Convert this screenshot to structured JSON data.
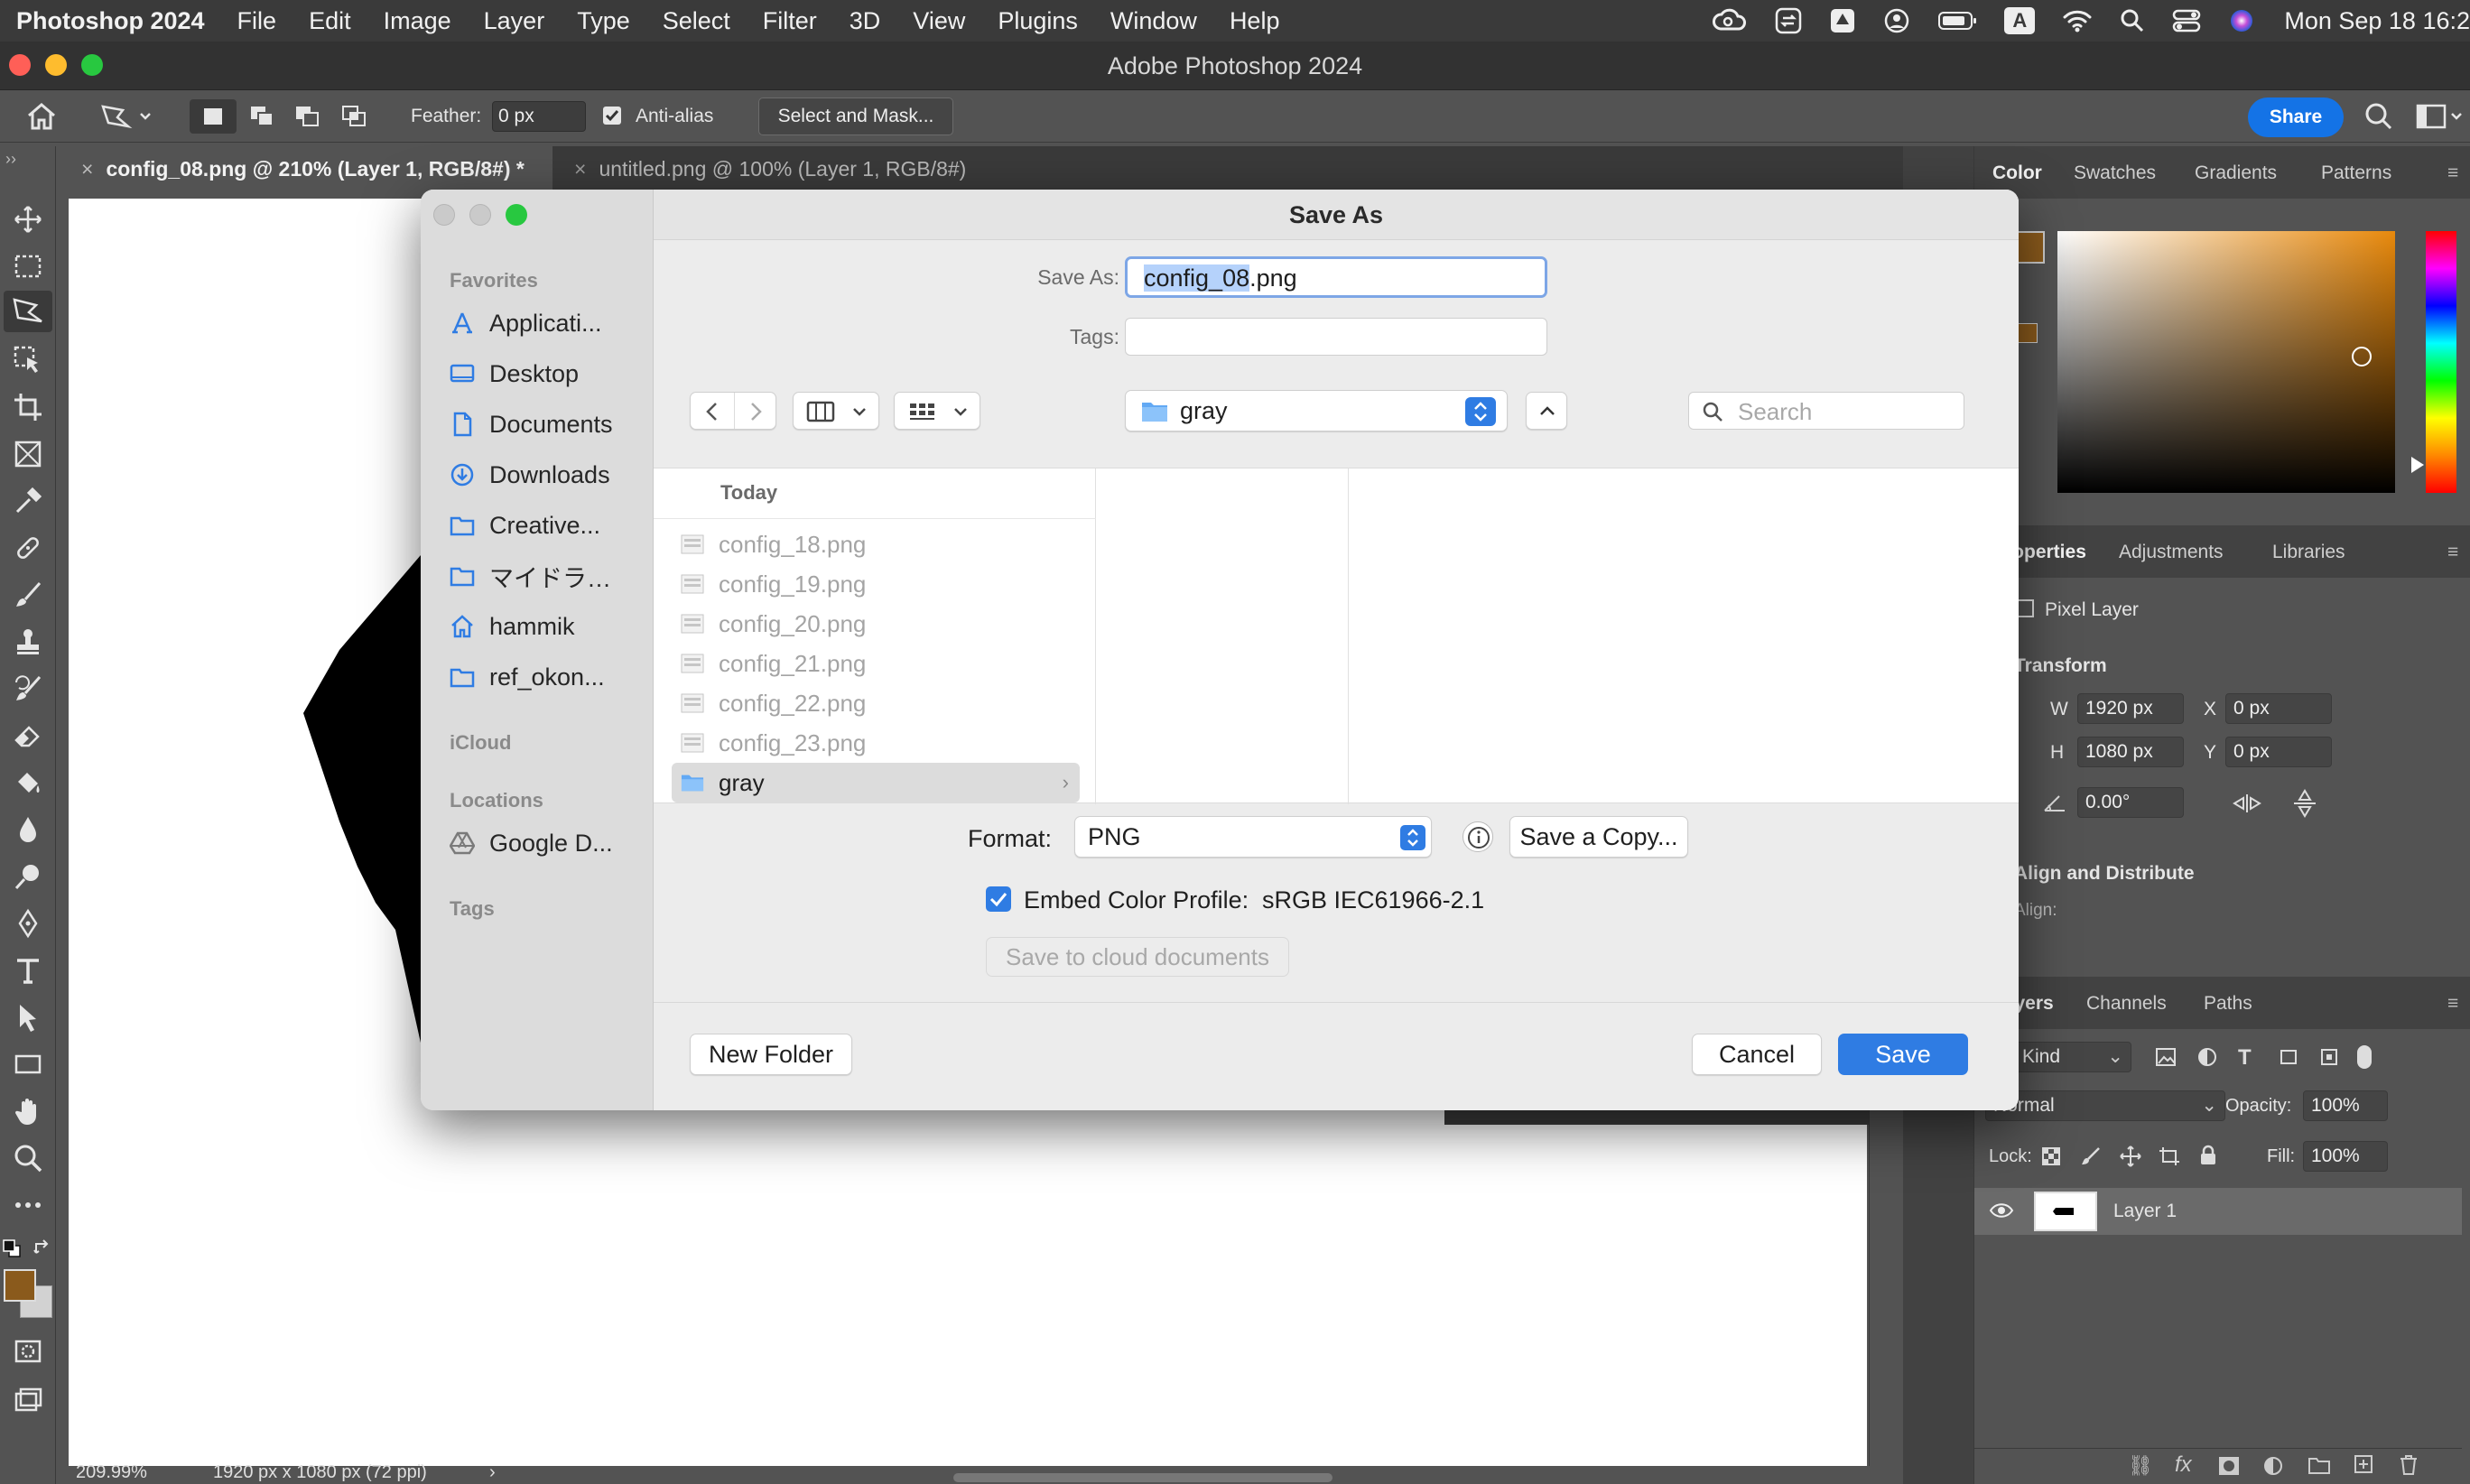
{
  "menubar": {
    "app": "Photoshop 2024",
    "items": [
      "File",
      "Edit",
      "Image",
      "Layer",
      "Type",
      "Select",
      "Filter",
      "3D",
      "View",
      "Plugins",
      "Window",
      "Help"
    ],
    "clock": "Mon Sep 18  16:2",
    "input_indicator": "A"
  },
  "window": {
    "title": "Adobe Photoshop 2024"
  },
  "options": {
    "feather_label": "Feather:",
    "feather_value": "0 px",
    "antialias_label": "Anti-alias",
    "antialias_checked": true,
    "select_mask": "Select and Mask...",
    "share": "Share"
  },
  "tabs": [
    {
      "label": "config_08.png @ 210% (Layer 1, RGB/8#) *",
      "active": true
    },
    {
      "label": "untitled.png @ 100% (Layer 1, RGB/8#)",
      "active": false
    }
  ],
  "status": {
    "zoom": "209.99%",
    "doc_size": "1920 px x 1080 px (72 ppi)",
    "arrow": "›"
  },
  "color_panel": {
    "tabs": [
      "Color",
      "Swatches",
      "Gradients",
      "Patterns"
    ],
    "fg": "#8a5a1c",
    "hue": "#e8890c"
  },
  "properties": {
    "tabs": [
      "Properties",
      "Adjustments",
      "Libraries"
    ],
    "type": "Pixel Layer",
    "transform_label": "Transform",
    "w_label": "W",
    "w": "1920 px",
    "h_label": "H",
    "h": "1080 px",
    "x_label": "X",
    "x": "0 px",
    "y_label": "Y",
    "y": "0 px",
    "angle": "0.00°",
    "align_label": "Align and Distribute",
    "align_sub": "Align:"
  },
  "layers": {
    "tabs": [
      "Layers",
      "Channels",
      "Paths"
    ],
    "filter": "Kind",
    "blend": "Normal",
    "opacity_label": "Opacity:",
    "opacity": "100%",
    "lock_label": "Lock:",
    "fill_label": "Fill:",
    "fill": "100%",
    "layer_name": "Layer 1"
  },
  "dialog": {
    "title": "Save As",
    "save_as_label": "Save As:",
    "filename": "config_08.png",
    "filename_selected": "config_08",
    "filename_ext": ".png",
    "tags_label": "Tags:",
    "location": "gray",
    "search_placeholder": "Search",
    "sidebar": {
      "favorites_header": "Favorites",
      "favorites": [
        {
          "label": "Applicati...",
          "icon": "applications-icon"
        },
        {
          "label": "Desktop",
          "icon": "desktop-icon"
        },
        {
          "label": "Documents",
          "icon": "document-icon"
        },
        {
          "label": "Downloads",
          "icon": "downloads-icon"
        },
        {
          "label": "Creative...",
          "icon": "folder-icon"
        },
        {
          "label": "マイドラ…",
          "icon": "folder-icon"
        },
        {
          "label": "hammik",
          "icon": "home-icon"
        },
        {
          "label": "ref_okon...",
          "icon": "folder-icon"
        }
      ],
      "icloud_header": "iCloud",
      "locations_header": "Locations",
      "locations": [
        {
          "label": "Google D...",
          "icon": "google-drive-icon"
        }
      ],
      "tags_header": "Tags"
    },
    "list_header": "Today",
    "files": [
      "config_18.png",
      "config_19.png",
      "config_20.png",
      "config_21.png",
      "config_22.png",
      "config_23.png"
    ],
    "selected_folder": "gray",
    "format_label": "Format:",
    "format": "PNG",
    "save_copy": "Save a Copy...",
    "embed_label": "Embed Color Profile:",
    "embed_value": "sRGB IEC61966-2.1",
    "embed_checked": true,
    "cloud_button": "Save to cloud documents",
    "new_folder": "New Folder",
    "cancel": "Cancel",
    "save": "Save"
  }
}
